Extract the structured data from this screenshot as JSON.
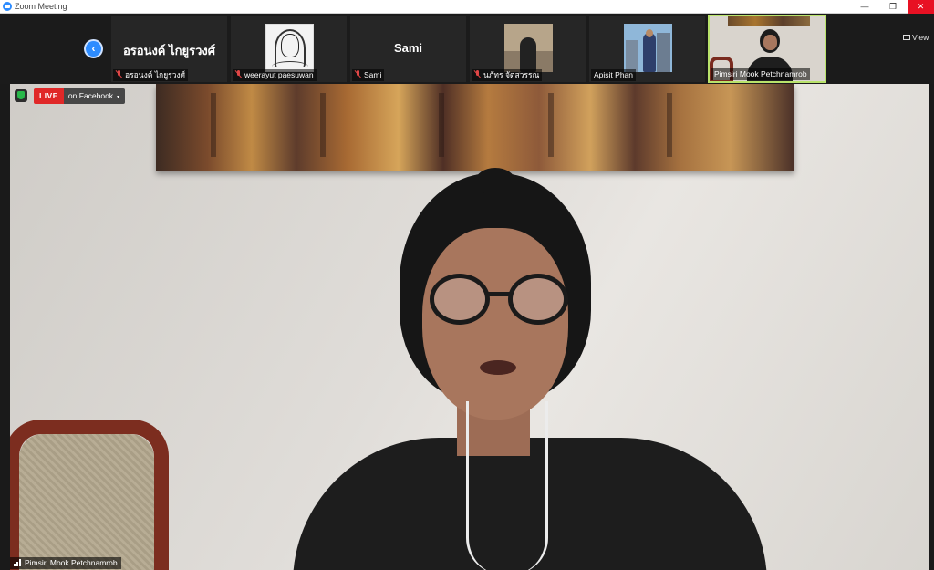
{
  "window": {
    "title": "Zoom Meeting",
    "min_glyph": "—",
    "max_glyph": "❐",
    "close_glyph": "✕"
  },
  "gallery": {
    "nav_glyph": "‹",
    "view_label": "View",
    "participants": [
      {
        "display_text": "อรอนงค์ ไกยูรวงศ์",
        "name": "อรอนงค์ ไกยูรวงศ์",
        "muted": true,
        "video": false
      },
      {
        "name": "weerayut paesuwan",
        "muted": true,
        "video": true,
        "thumb": "sketch-portrait"
      },
      {
        "display_text": "Sami",
        "name": "Sami",
        "muted": true,
        "video": false
      },
      {
        "name": "นภัทร จัตสวรรณ",
        "muted": true,
        "video": true,
        "thumb": "photo-portrait"
      },
      {
        "name": "Apisit Phan",
        "muted": false,
        "video": true,
        "thumb": "photo-city"
      },
      {
        "name": "Pimsiri Mook Petchnamrob",
        "muted": false,
        "video": true,
        "active_speaker": true
      }
    ]
  },
  "stream": {
    "live_label": "LIVE",
    "target_label": "on Facebook",
    "caret": "▾"
  },
  "speaker": {
    "name": "Pimsiri Mook Petchnamrob"
  },
  "colors": {
    "accent": "#2d8cff",
    "live": "#e02828",
    "active_border": "#b9e36b",
    "muted_icon": "#e04646",
    "security": "#29b84a"
  }
}
